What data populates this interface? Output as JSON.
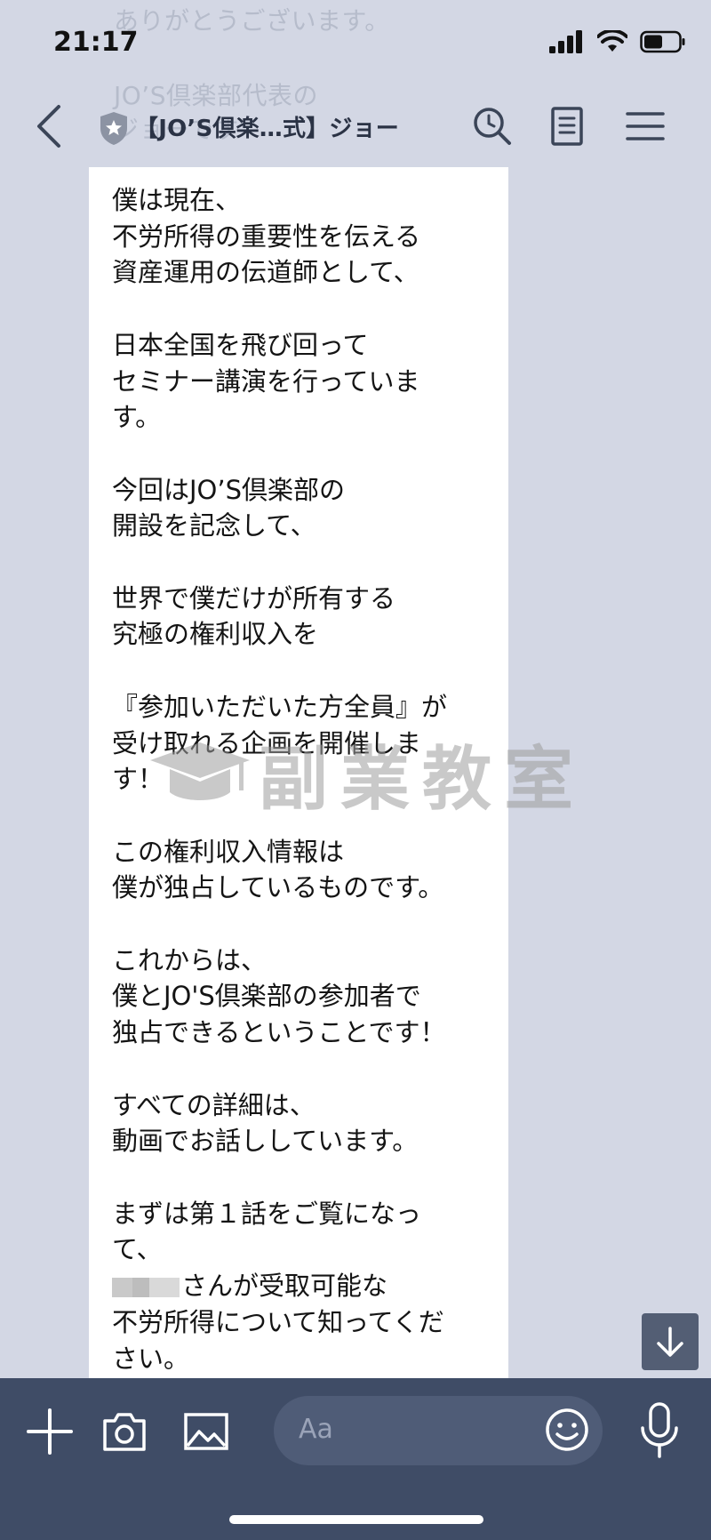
{
  "background_messages": {
    "line1": "ありがとうございます。",
    "line2": "JO’S倶楽部代表の",
    "line3": "ジョーです"
  },
  "status_bar": {
    "time": "21:17"
  },
  "header": {
    "title": "【JO’S倶楽…式】ジョー"
  },
  "message": {
    "text_before_name": "僕は現在、\n不労所得の重要性を伝える\n資産運用の伝道師として、\n\n日本全国を飛び回って\nセミナー講演を行っていま\nす。\n\n今回はJO’S倶楽部の\n開設を記念して、\n\n世界で僕だけが所有する\n究極の権利収入を\n\n『参加いただいた方全員』が\n受け取れる企画を開催しま\nす！\n\nこの権利収入情報は\n僕が独占しているものです。\n\nこれからは、\n僕とJO'S倶楽部の参加者で\n独占できるということです！\n\nすべての詳細は、\n動画でお話ししています。\n\nまずは第１話をご覧になっ\nて、\n",
    "text_after_name": "さんが受取可能な\n不労所得について知ってくだ\nさい。"
  },
  "watermark": {
    "text": "副業教室"
  },
  "input": {
    "placeholder": "Aa"
  },
  "colors": {
    "chat_background": "#d3d7e4",
    "bubble": "#ffffff",
    "bottom_bar": "#3f4c66",
    "input_field": "#4f5c77",
    "header_icons": "#3b4558"
  },
  "icons": {
    "back": "chevron-left-icon",
    "official_badge": "shield-star-icon",
    "search": "search-icon",
    "notes": "note-icon",
    "menu": "hamburger-icon",
    "scroll_down": "arrow-down-icon",
    "add": "plus-icon",
    "camera": "camera-icon",
    "image": "image-icon",
    "emoji": "smiley-icon",
    "mic": "microphone-icon"
  }
}
